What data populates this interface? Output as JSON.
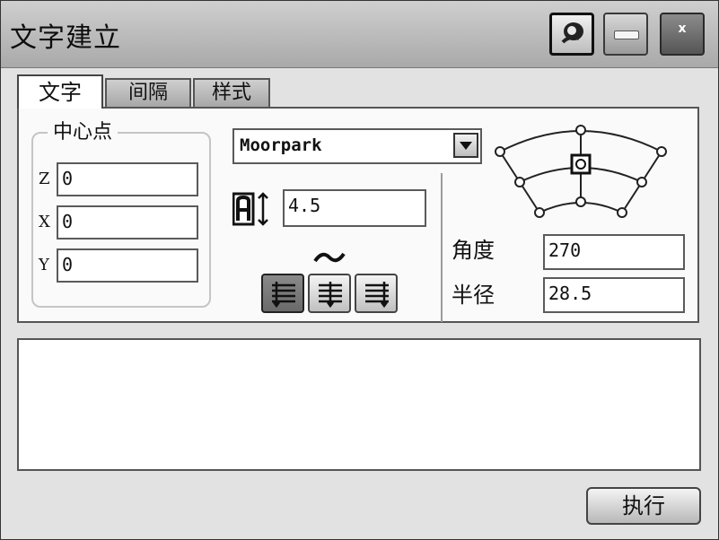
{
  "window": {
    "title": "文字建立"
  },
  "titlebar": {
    "buttons": [
      "pin-icon",
      "minimize-icon",
      "close-icon"
    ],
    "close_label": "x"
  },
  "tabs": [
    {
      "label": "文字",
      "active": true
    },
    {
      "label": "间隔",
      "active": false
    },
    {
      "label": "样式",
      "active": false
    }
  ],
  "center_point": {
    "title": "中心点",
    "z": {
      "label": "Z",
      "value": "0"
    },
    "x": {
      "label": "X",
      "value": "0"
    },
    "y": {
      "label": "Y",
      "value": "0"
    }
  },
  "font": {
    "selected": "Moorpark"
  },
  "text_height": {
    "value": "4.5",
    "icon": "text-height-icon"
  },
  "alignment": {
    "icons": [
      "align-left-icon",
      "align-center-icon",
      "align-right-icon"
    ],
    "selected_index": 0,
    "curve_icon": "curve-tilde-icon"
  },
  "arc": {
    "angle_label": "角度",
    "angle_value": "270",
    "radius_label": "半径",
    "radius_value": "28.5",
    "selected_anchor": "center"
  },
  "footer": {
    "execute_label": "执行"
  },
  "colors": {
    "titlebar": "#b8b8b8",
    "panel": "#fafafa",
    "pressed_button": "#7a7a7a"
  }
}
